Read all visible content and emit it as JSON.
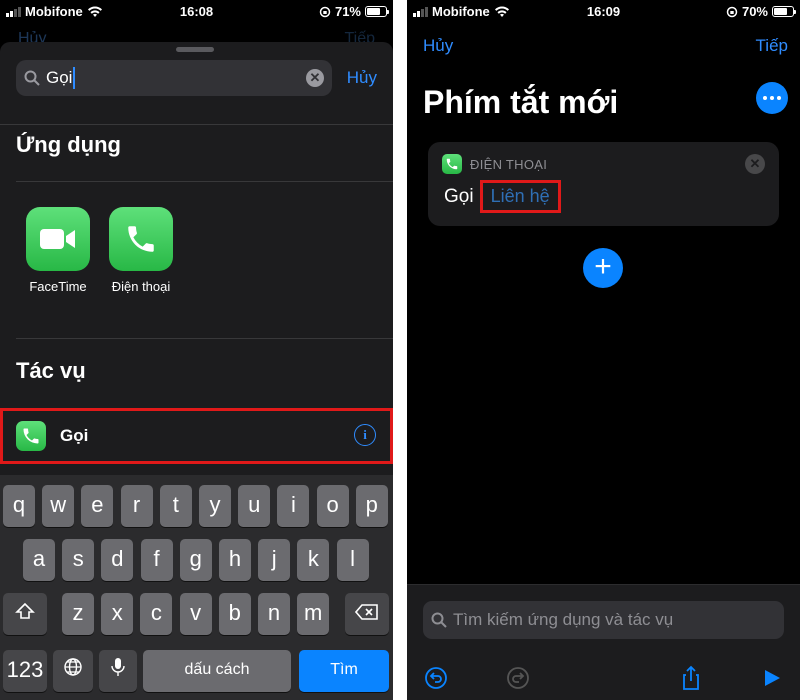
{
  "left": {
    "status": {
      "carrier": "Mobifone",
      "time": "16:08",
      "battery": "71%",
      "battery_level": 0.71
    },
    "background_peek": {
      "left": "Hủy",
      "right": "Tiếp"
    },
    "search": {
      "value": "Gọi",
      "cancel": "Hủy"
    },
    "apps_section": {
      "title": "Ứng dụng",
      "apps": [
        {
          "name": "FaceTime",
          "icon": "video-camera-icon"
        },
        {
          "name": "Điện thoại",
          "icon": "phone-icon"
        }
      ]
    },
    "actions_section": {
      "title": "Tác vụ",
      "items": [
        {
          "label": "Gọi",
          "icon": "phone-icon"
        }
      ]
    },
    "keyboard": {
      "row1": [
        "q",
        "w",
        "e",
        "r",
        "t",
        "y",
        "u",
        "i",
        "o",
        "p"
      ],
      "row2": [
        "a",
        "s",
        "d",
        "f",
        "g",
        "h",
        "j",
        "k",
        "l"
      ],
      "row3": [
        "z",
        "x",
        "c",
        "v",
        "b",
        "n",
        "m"
      ],
      "num": "123",
      "space": "dấu cách",
      "search": "Tìm"
    }
  },
  "right": {
    "status": {
      "carrier": "Mobifone",
      "time": "16:09",
      "battery": "70%",
      "battery_level": 0.7
    },
    "nav": {
      "cancel": "Hủy",
      "next": "Tiếp"
    },
    "title": "Phím tắt mới",
    "card": {
      "app": "ĐIỆN THOẠI",
      "verb": "Gọi",
      "param": "Liên hệ"
    },
    "bottom_search_placeholder": "Tìm kiếm ứng dụng và tác vụ"
  },
  "colors": {
    "accent": "#0a84ff",
    "highlight": "#e01919",
    "phone_green": "#34c759"
  }
}
